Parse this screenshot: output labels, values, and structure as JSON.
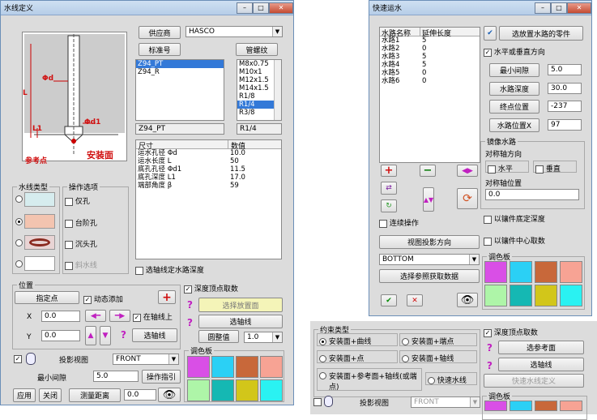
{
  "w1": {
    "title": "水线定义",
    "supplier_btn": "供应商",
    "supplier_val": "HASCO",
    "std_btn": "标准号",
    "thread_btn": "管螺纹",
    "std_list": [
      "Z94_PT",
      "Z94_R"
    ],
    "std_sel": "Z94_PT",
    "thread_list": [
      "M8x0.75",
      "M10x1",
      "M12x1.5",
      "M14x1.5",
      "R1/8",
      "R1/4",
      "R3/8"
    ],
    "thread_sel": "R1/4",
    "label_phid": "Φd",
    "label_l": "L",
    "label_l1": "L1",
    "label_phid1": "Φd1",
    "label_refpt": "参考点",
    "label_mount": "安装面",
    "col_size": "尺寸",
    "col_value": "数值",
    "params": [
      {
        "n": "运水孔径 Φd",
        "v": "10.0"
      },
      {
        "n": "运水长度 L",
        "v": "50"
      },
      {
        "n": "底孔孔径 Φd1",
        "v": "11.5"
      },
      {
        "n": "底孔深度 L1",
        "v": "17.0"
      },
      {
        "n": "端部角度 β",
        "v": "59"
      }
    ],
    "type_group": "水线类型",
    "op_group": "操作选项",
    "op1": "仅孔",
    "op2": "台阶孔",
    "op3": "沉头孔",
    "op4": "斜水线",
    "chk_select": "选轴线定水路深度",
    "pos_group": "位置",
    "pick_btn": "指定点",
    "dyn_add": "动态添加",
    "x": "X",
    "y": "Y",
    "x_val": "0.0",
    "y_val": "0.0",
    "on_axis": "在轴线上",
    "sel_axis_btn": "选轴线",
    "depth_chk": "深度顶点取数",
    "sel_plane_btn": "选择放置面",
    "sel_axis2_btn": "选轴线",
    "round_btn": "圆整值",
    "round_val": "1.0",
    "proj_btn": "投影视图",
    "proj_val": "FRONT",
    "min_gap": "最小间隙",
    "min_gap_val": "5.0",
    "op_guide": "操作指引",
    "palette": "调色板",
    "apply": "应用",
    "close": "关闭",
    "measure": "测量距离",
    "measure_val": "0.0",
    "q": "?"
  },
  "w2": {
    "title": "快速运水",
    "col_name": "水路名称",
    "col_ext": "延伸长度",
    "rows": [
      {
        "n": "水路1",
        "v": "5"
      },
      {
        "n": "水路2",
        "v": "0"
      },
      {
        "n": "水路3",
        "v": "5"
      },
      {
        "n": "水路4",
        "v": "5"
      },
      {
        "n": "水路5",
        "v": "0"
      },
      {
        "n": "水路6",
        "v": "0"
      }
    ],
    "sel_parts": "选放置水路的零件",
    "hv_dir": "水平或垂直方向",
    "min_gap": "最小间隙",
    "min_gap_val": "5.0",
    "depth": "水路深度",
    "depth_val": "30.0",
    "end_pos": "终点位置",
    "end_val": "-237",
    "pos_x": "水路位置X",
    "pos_x_val": "97",
    "mirror": "镜像水路",
    "axis_dir": "对称轴方向",
    "horiz": "水平",
    "vert": "垂直",
    "axis_pos": "对称轴位置",
    "axis_pos_val": "0.0",
    "base_depth": "以镶件底定深度",
    "center": "以镶件中心取数",
    "cont": "连续操作",
    "view_dir": "视图投影方向",
    "view_val": "BOTTOM",
    "sel_ref": "选择参照获取数据",
    "palette": "调色板"
  },
  "w3": {
    "group": "约束类型",
    "r1": "安装面+曲线",
    "r2": "安装面+端点",
    "r3": "安装面+点",
    "r4": "安装面+轴线",
    "r5": "安装面+参考面+轴线(或端点)",
    "r6": "快速水线",
    "depth_chk": "深度顶点取数",
    "sel_ref": "选参考面",
    "sel_axis": "选轴线",
    "quick_def": "快速水线定义",
    "proj": "投影视图",
    "proj_val": "FRONT",
    "palette": "调色板"
  },
  "palette": [
    "#d94fe6",
    "#2bd0f5",
    "#c8683a",
    "#f7a394",
    "#aef5a8",
    "#15b8b3",
    "#d2c61a",
    "#2af2f2"
  ]
}
